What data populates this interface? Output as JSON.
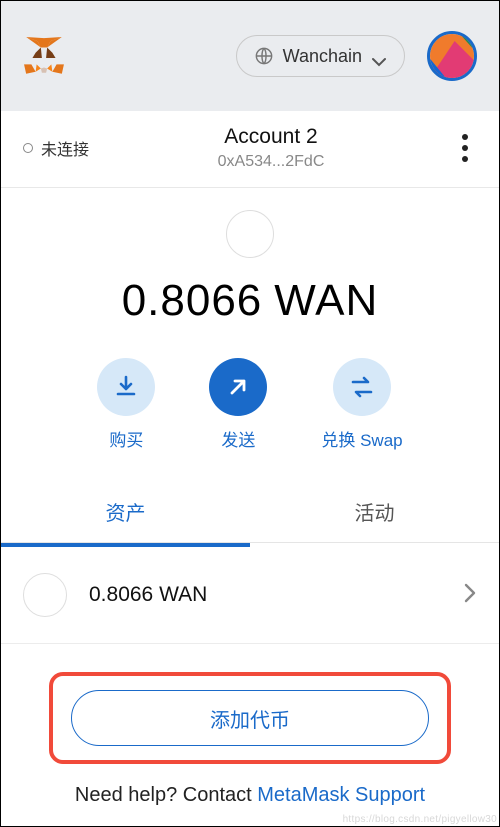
{
  "header": {
    "network_label": "Wanchain"
  },
  "account": {
    "connection_status": "未连接",
    "name": "Account 2",
    "address_short": "0xA534...2FdC"
  },
  "balance": {
    "amount": "0.8066",
    "symbol": "WAN"
  },
  "actions": {
    "buy_label": "购买",
    "send_label": "发送",
    "swap_label": "兑换 Swap"
  },
  "tabs": {
    "assets_label": "资产",
    "activity_label": "活动",
    "active_index": 0
  },
  "assets": [
    {
      "balance_display": "0.8066 WAN"
    }
  ],
  "add_token_label": "添加代币",
  "footer": {
    "help_prefix": "Need help? Contact ",
    "help_link_text": "MetaMask Support"
  },
  "watermark": "https://blog.csdn.net/pigyellow30"
}
